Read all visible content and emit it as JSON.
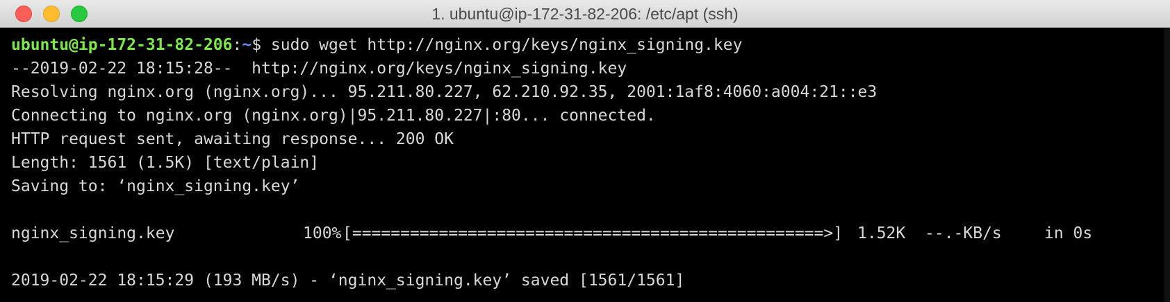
{
  "window": {
    "title": "1. ubuntu@ip-172-31-82-206: /etc/apt (ssh)"
  },
  "colors": {
    "prompt_user": "#7ce84a",
    "prompt_path": "#6e8cff",
    "text": "#d8d8d8",
    "background": "#000000"
  },
  "terminal": {
    "prompt": {
      "user_host": "ubuntu@ip-172-31-82-206",
      "separator": ":",
      "path": "~",
      "symbol": "$ ",
      "command": "sudo wget http://nginx.org/keys/nginx_signing.key"
    },
    "output": [
      "--2019-02-22 18:15:28--  http://nginx.org/keys/nginx_signing.key",
      "Resolving nginx.org (nginx.org)... 95.211.80.227, 62.210.92.35, 2001:1af8:4060:a004:21::e3",
      "Connecting to nginx.org (nginx.org)|95.211.80.227|:80... connected.",
      "HTTP request sent, awaiting response... 200 OK",
      "Length: 1561 (1.5K) [text/plain]",
      "Saving to: ‘nginx_signing.key’"
    ],
    "progress": {
      "filename": "nginx_signing.key",
      "percent": "100%",
      "bar": "[=================================================>]",
      "size": "1.52K",
      "speed": "--.-KB/s",
      "time": "in 0s"
    },
    "final": "2019-02-22 18:15:29 (193 MB/s) - ‘nginx_signing.key’ saved [1561/1561]"
  }
}
